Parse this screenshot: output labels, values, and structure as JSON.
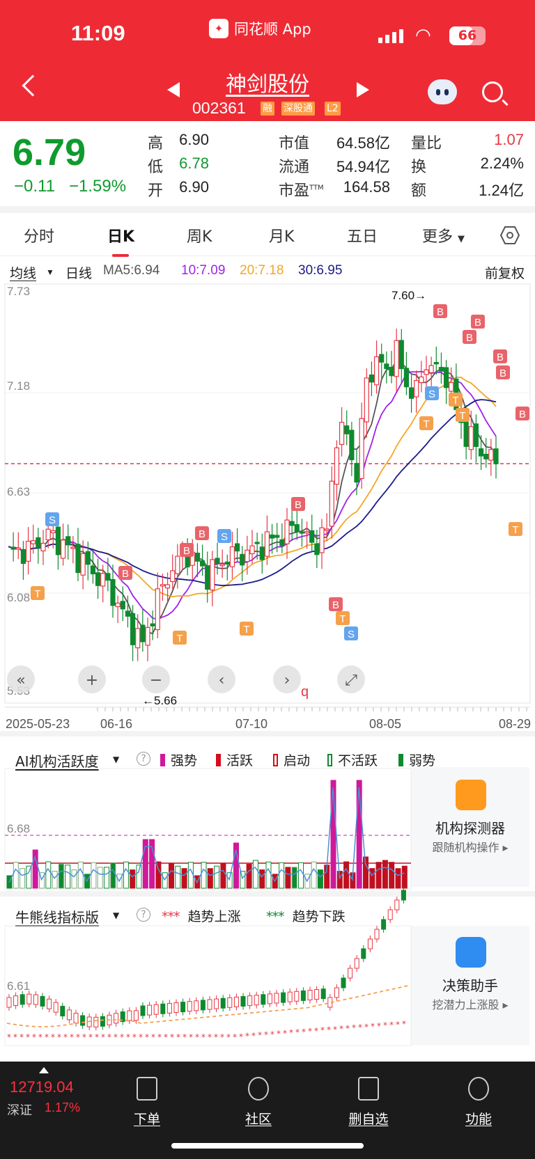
{
  "status": {
    "time": "11:09",
    "app": "同花顺 App",
    "battery": "66",
    "battery_level": 0.66
  },
  "header": {
    "name": "神剑股份",
    "code": "002361",
    "tags": [
      "融",
      "深股通",
      "L2"
    ]
  },
  "quote": {
    "price": "6.79",
    "change": "−0.11",
    "pct": "−1.59%",
    "stats": [
      [
        {
          "l": "高",
          "v": "6.90"
        },
        {
          "l": "市值",
          "v": "64.58亿"
        },
        {
          "l": "量比",
          "v": "1.07"
        }
      ],
      [
        {
          "l": "低",
          "v": "6.78"
        },
        {
          "l": "流通",
          "v": "54.94亿"
        },
        {
          "l": "换",
          "v": "2.24%"
        }
      ],
      [
        {
          "l": "开",
          "v": "6.90"
        },
        {
          "l": "市盈",
          "sup": "TTM",
          "v": "164.58"
        },
        {
          "l": "额",
          "v": "1.24亿"
        }
      ]
    ]
  },
  "tabs": [
    "分时",
    "日K",
    "周K",
    "月K",
    "五日",
    "更多"
  ],
  "ma_row": {
    "selector": "均线",
    "period": "日线",
    "ma5": "MA5:6.94",
    "ma10": "10:7.09",
    "ma20": "20:7.18",
    "ma30": "30:6.95",
    "adjust": "前复权"
  },
  "colors": {
    "up": "#e63744",
    "down": "#0e8a2e",
    "ma5": "#555555",
    "ma10": "#a020f0",
    "ma20": "#f5a623",
    "ma30": "#1a1a8a"
  },
  "main_chart": {
    "y_labels": [
      "7.73",
      "7.18",
      "6.63",
      "6.08",
      "5.53"
    ],
    "x_labels": [
      "2025-05-23",
      "06-16",
      "07-10",
      "08-05",
      "08-29"
    ],
    "high_annot": "7.60→",
    "low_annot": "←5.66",
    "ref_line": 6.79,
    "markers": [
      "B",
      "S",
      "T"
    ],
    "q_mark": "q"
  },
  "ai_panel": {
    "title": "AI机构活跃度",
    "help": "?",
    "y_label": "6.68",
    "legend": [
      "强势",
      "活跃",
      "启动",
      "不活跃",
      "弱势"
    ],
    "card": {
      "t1": "机构探测器",
      "t2": "跟随机构操作 ▸"
    }
  },
  "bull_panel": {
    "title": "牛熊线指标版",
    "help": "?",
    "y_label": "6.61",
    "legend": [
      "趋势上涨",
      "趋势下跌"
    ],
    "legend_marks": [
      "***",
      "***"
    ],
    "card": {
      "t1": "决策助手",
      "t2": "挖潜力上涨股 ▸"
    }
  },
  "footer": {
    "index_value": "12719.04",
    "index_name": "深证",
    "index_pct": "1.17%",
    "nav": [
      "下单",
      "社区",
      "删自选",
      "功能"
    ]
  }
}
